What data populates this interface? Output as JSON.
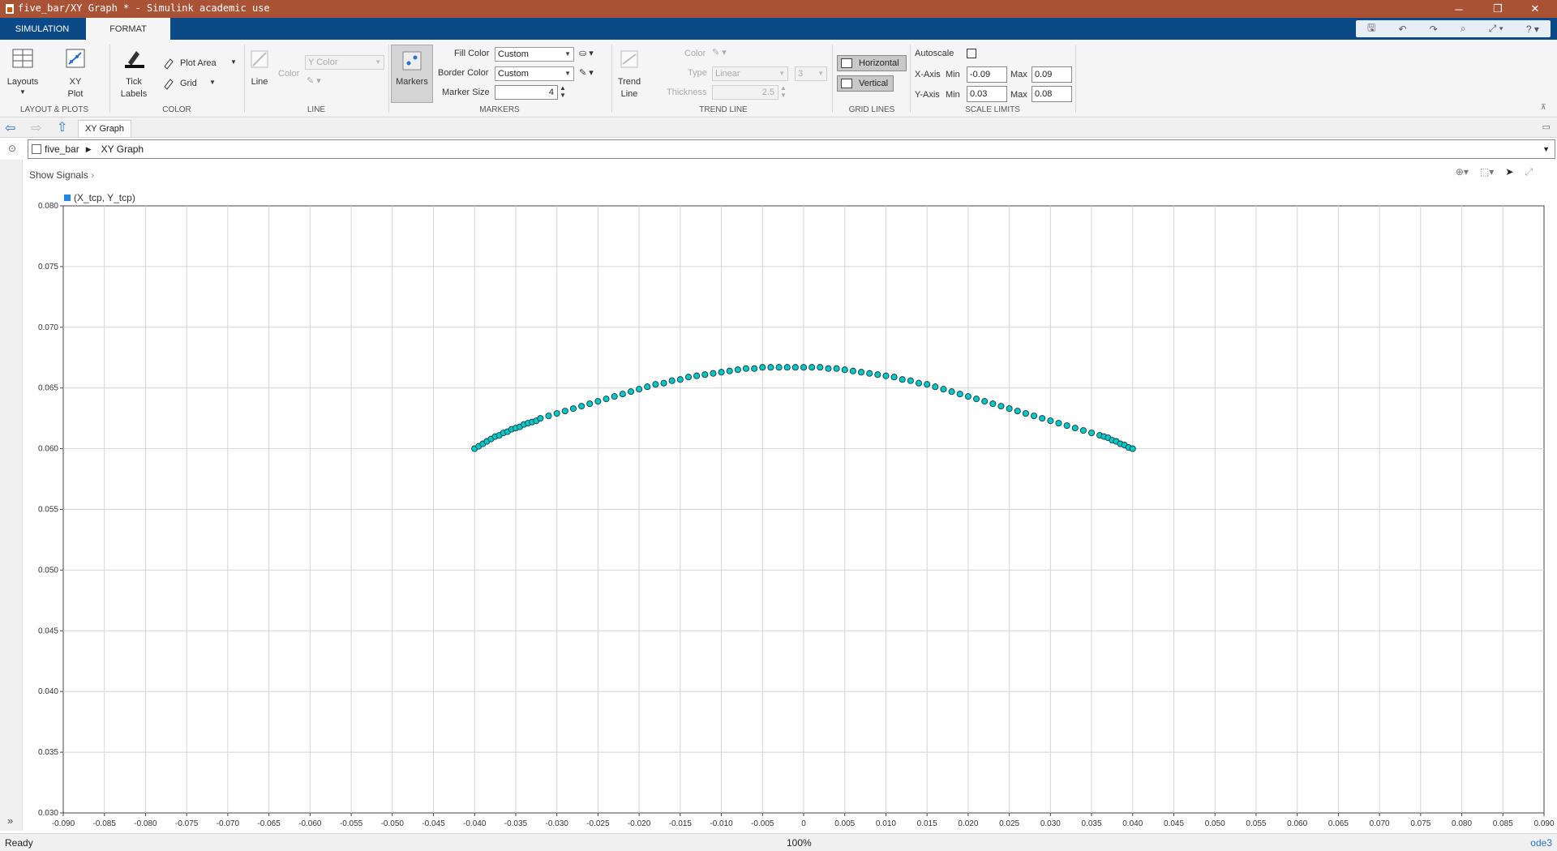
{
  "window": {
    "title": "five_bar/XY Graph * - Simulink academic use",
    "minimize": "─",
    "restore": "❐",
    "close": "✕"
  },
  "tabs": [
    {
      "label": "SIMULATION",
      "active": false
    },
    {
      "label": "FORMAT",
      "active": true
    }
  ],
  "quick_access": [
    "save-icon",
    "undo-icon",
    "redo-icon",
    "search-icon",
    "zoom-tool-icon",
    "help-icon"
  ],
  "ribbon": {
    "layouts": {
      "label": "Layouts"
    },
    "xy_plot": {
      "label": "XY\nPlot",
      "line1": "XY",
      "line2": "Plot"
    },
    "layout_section": "LAYOUT & PLOTS",
    "tick_labels": {
      "line1": "Tick",
      "line2": "Labels"
    },
    "plot_area": "Plot Area",
    "grid": "Grid",
    "color_section": "COLOR",
    "line_btn": "Line",
    "line_color_label": "Color",
    "y_color": "Y Color",
    "line_section": "LINE",
    "markers_btn": "Markers",
    "fill_color_label": "Fill Color",
    "fill_color_value": "Custom",
    "border_color_label": "Border Color",
    "border_color_value": "Custom",
    "marker_size_label": "Marker Size",
    "marker_size_value": "4",
    "markers_section": "MARKERS",
    "trend_line": {
      "line1": "Trend",
      "line2": "Line"
    },
    "trend_color_label": "Color",
    "trend_type_label": "Type",
    "trend_type_value": "Linear",
    "trend_order_value": "3",
    "thickness_label": "Thickness",
    "thickness_value": "2.5",
    "trend_section": "TREND LINE",
    "horizontal": "Horizontal",
    "vertical": "Vertical",
    "grid_section": "GRID LINES",
    "autoscale_label": "Autoscale",
    "autoscale_checked": false,
    "x_axis_label": "X-Axis",
    "y_axis_label": "Y-Axis",
    "min_label": "Min",
    "max_label": "Max",
    "x_min": "-0.09",
    "x_max": "0.09",
    "y_min": "0.03",
    "y_max": "0.08",
    "scale_section": "SCALE LIMITS"
  },
  "nav": {
    "tab": "XY Graph"
  },
  "breadcrumb": {
    "root": "five_bar",
    "separator": "▶",
    "current": "XY Graph"
  },
  "show_signals": "Show Signals",
  "legend": {
    "label": "(X_tcp, Y_tcp)",
    "color": "#1e87e5"
  },
  "chart_data": {
    "type": "scatter",
    "title": "",
    "xlabel": "",
    "ylabel": "",
    "xlim": [
      -0.09,
      0.09
    ],
    "ylim": [
      0.03,
      0.08
    ],
    "x_ticks": [
      "-0.090",
      "-0.085",
      "-0.080",
      "-0.075",
      "-0.070",
      "-0.065",
      "-0.060",
      "-0.055",
      "-0.050",
      "-0.045",
      "-0.040",
      "-0.035",
      "-0.030",
      "-0.025",
      "-0.020",
      "-0.015",
      "-0.010",
      "-0.005",
      "0",
      "0.005",
      "0.010",
      "0.015",
      "0.020",
      "0.025",
      "0.030",
      "0.035",
      "0.040",
      "0.045",
      "0.050",
      "0.055",
      "0.060",
      "0.065",
      "0.070",
      "0.075",
      "0.080",
      "0.085",
      "0.090"
    ],
    "y_ticks": [
      "0.030",
      "0.035",
      "0.040",
      "0.045",
      "0.050",
      "0.055",
      "0.060",
      "0.065",
      "0.070",
      "0.075",
      "0.080"
    ],
    "grid": true,
    "marker_color": "#00c8c8",
    "series": [
      {
        "name": "(X_tcp, Y_tcp)",
        "x": [
          -0.04,
          -0.0395,
          -0.039,
          -0.0385,
          -0.038,
          -0.0375,
          -0.037,
          -0.0365,
          -0.036,
          -0.0355,
          -0.035,
          -0.0345,
          -0.034,
          -0.0335,
          -0.033,
          -0.0325,
          -0.032,
          -0.031,
          -0.03,
          -0.029,
          -0.028,
          -0.027,
          -0.026,
          -0.025,
          -0.024,
          -0.023,
          -0.022,
          -0.021,
          -0.02,
          -0.019,
          -0.018,
          -0.017,
          -0.016,
          -0.015,
          -0.014,
          -0.013,
          -0.012,
          -0.011,
          -0.01,
          -0.009,
          -0.008,
          -0.007,
          -0.006,
          -0.005,
          -0.004,
          -0.003,
          -0.002,
          -0.001,
          0.0,
          0.001,
          0.002,
          0.003,
          0.004,
          0.005,
          0.006,
          0.007,
          0.008,
          0.009,
          0.01,
          0.011,
          0.012,
          0.013,
          0.014,
          0.015,
          0.016,
          0.017,
          0.018,
          0.019,
          0.02,
          0.021,
          0.022,
          0.023,
          0.024,
          0.025,
          0.026,
          0.027,
          0.028,
          0.029,
          0.03,
          0.031,
          0.032,
          0.033,
          0.034,
          0.035,
          0.036,
          0.0365,
          0.037,
          0.0375,
          0.038,
          0.0385,
          0.039,
          0.0395,
          0.04
        ],
        "y": [
          0.06,
          0.0602,
          0.0604,
          0.0606,
          0.0608,
          0.061,
          0.0611,
          0.0613,
          0.0614,
          0.0616,
          0.0617,
          0.0618,
          0.062,
          0.0621,
          0.0622,
          0.0623,
          0.0625,
          0.0627,
          0.0629,
          0.0631,
          0.0633,
          0.0635,
          0.0637,
          0.0639,
          0.0641,
          0.0643,
          0.0645,
          0.0647,
          0.0649,
          0.0651,
          0.0653,
          0.0654,
          0.0656,
          0.0657,
          0.0659,
          0.066,
          0.0661,
          0.0662,
          0.0663,
          0.0664,
          0.0665,
          0.0666,
          0.0666,
          0.0667,
          0.0667,
          0.0667,
          0.0667,
          0.0667,
          0.0667,
          0.0667,
          0.0667,
          0.0666,
          0.0666,
          0.0665,
          0.0664,
          0.0663,
          0.0662,
          0.0661,
          0.066,
          0.0659,
          0.0657,
          0.0656,
          0.0654,
          0.0653,
          0.0651,
          0.0649,
          0.0647,
          0.0645,
          0.0643,
          0.0641,
          0.0639,
          0.0637,
          0.0635,
          0.0633,
          0.0631,
          0.0629,
          0.0627,
          0.0625,
          0.0623,
          0.0621,
          0.0619,
          0.0617,
          0.0615,
          0.0613,
          0.0611,
          0.061,
          0.0609,
          0.0607,
          0.0606,
          0.0604,
          0.0603,
          0.0601,
          0.06
        ]
      }
    ]
  },
  "status": {
    "left": "Ready",
    "center": "100%",
    "right": "ode3"
  }
}
